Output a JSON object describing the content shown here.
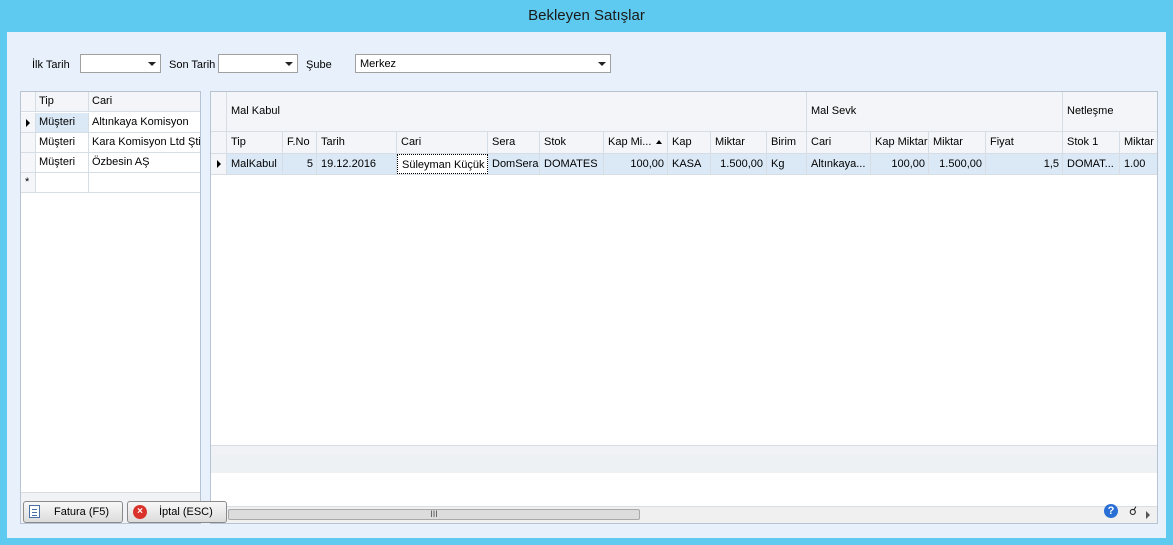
{
  "window": {
    "title": "Bekleyen Satışlar"
  },
  "filters": {
    "ilk_tarih_label": "İlk Tarih",
    "ilk_tarih_value": "",
    "son_tarih_label": "Son Tarih",
    "son_tarih_value": "",
    "sube_label": "Şube",
    "sube_value": "Merkez"
  },
  "left_grid": {
    "headers": [
      "Tip",
      "Cari"
    ],
    "rows": [
      {
        "tip": "Müşteri",
        "cari": "Altınkaya Komisyon"
      },
      {
        "tip": "Müşteri",
        "cari": "Kara Komisyon Ltd Şti"
      },
      {
        "tip": "Müşteri",
        "cari": "Özbesin AŞ"
      }
    ],
    "new_row_marker": "*"
  },
  "main_grid": {
    "bands": [
      "Mal Kabul",
      "Mal Sevk",
      "Netleşme"
    ],
    "columns": [
      "Tip",
      "F.No",
      "Tarih",
      "Cari",
      "Sera",
      "Stok",
      "Kap Mi...",
      "Kap",
      "Miktar",
      "Birim",
      "Cari",
      "Kap Miktar",
      "Miktar",
      "Fiyat",
      "Stok 1",
      "Miktar"
    ],
    "sorted_column": "Kap Mi...",
    "rows": [
      [
        "MalKabul",
        "5",
        "19.12.2016",
        "Süleyman Küçük",
        "DomSera",
        "DOMATES",
        "100,00",
        "KASA",
        "1.500,00",
        "Kg",
        "Altınkaya...",
        "100,00",
        "1.500,00",
        "1,5",
        "DOMAT...",
        "1.00"
      ]
    ]
  },
  "scrollbar": {
    "thumb_grip": "III"
  },
  "buttons": {
    "fatura": "Fatura (F5)",
    "iptal": "İptal (ESC)"
  },
  "icons": {
    "help": "?",
    "support": "headset-icon",
    "cancel": "×"
  }
}
